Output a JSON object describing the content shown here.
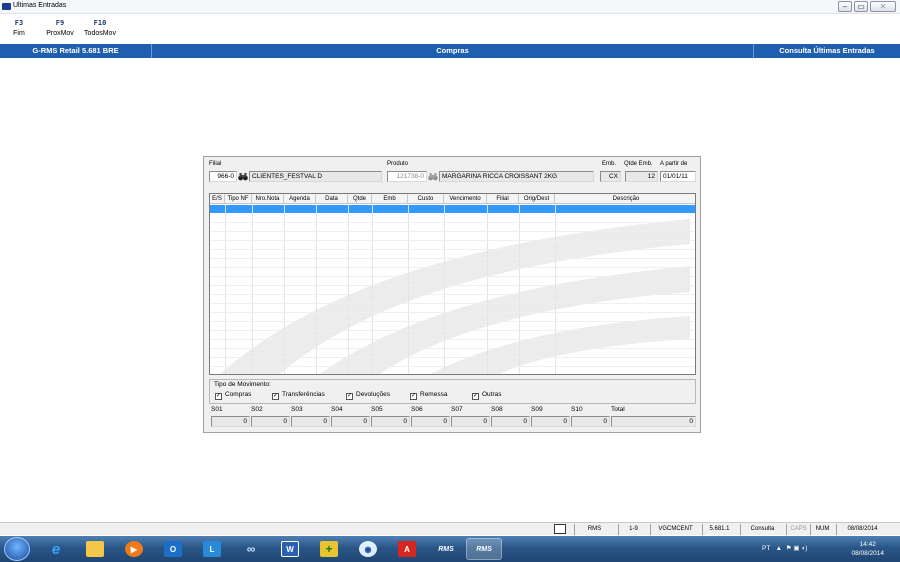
{
  "window": {
    "title": "Ultimas Entradas"
  },
  "toolbar": {
    "keys": [
      {
        "key": "F3",
        "label": "Fim"
      },
      {
        "key": "F9",
        "label": "ProxMov"
      },
      {
        "key": "F10",
        "label": "TodosMov"
      }
    ]
  },
  "header": {
    "system": "G-RMS Retail 5.681 BRE",
    "module": "Compras",
    "screen": "Consulta Últimas Entradas"
  },
  "form": {
    "filial_label": "Filial",
    "filial_code": "966-0",
    "filial_name": "CLIENTES_FESTVAL D",
    "produto_label": "Produto",
    "produto_code": "121738-0",
    "produto_desc": "MARGARINA RICCA CROISSANT 2KG",
    "emb_label": "Emb.",
    "emb_value": "CX",
    "qtde_emb_label": "Qtde Emb.",
    "qtde_emb_value": "12",
    "a_partir_label": "A partir de",
    "a_partir_value": "01/01/11"
  },
  "grid": {
    "columns": [
      "E/S",
      "Tipo NF",
      "Nro.Nota",
      "Agenda",
      "Data",
      "Qtde",
      "Emb",
      "Custo",
      "Vencimento",
      "Filial",
      "Orig/Dest",
      "Descrição"
    ],
    "rows": []
  },
  "movement": {
    "legend": "Tipo de Movimento:",
    "options": [
      {
        "label": "Compras",
        "checked": true
      },
      {
        "label": "Transferências",
        "checked": true
      },
      {
        "label": "Devoluções",
        "checked": true
      },
      {
        "label": "Remessa",
        "checked": true
      },
      {
        "label": "Outras",
        "checked": true
      }
    ]
  },
  "totals": {
    "labels": [
      "S01",
      "S02",
      "S03",
      "S04",
      "S05",
      "S06",
      "S07",
      "S08",
      "S09",
      "S10",
      "Total"
    ],
    "values": [
      "0",
      "0",
      "0",
      "0",
      "0",
      "0",
      "0",
      "0",
      "0",
      "0",
      "0"
    ]
  },
  "statusbar": {
    "items": [
      "RMS",
      "1-9",
      "VGCMCENT",
      "5.681.1",
      "Consulta",
      "CAPS",
      "NUM",
      "08/08/2014"
    ]
  },
  "taskbar": {
    "language": "PT",
    "time": "14:42",
    "date": "08/08/2014",
    "rms_label": "RMS"
  },
  "colors": {
    "header_blue": "#1f5fb0",
    "selection_blue": "#3399ff",
    "taskbar_blue": "#2a5687"
  }
}
